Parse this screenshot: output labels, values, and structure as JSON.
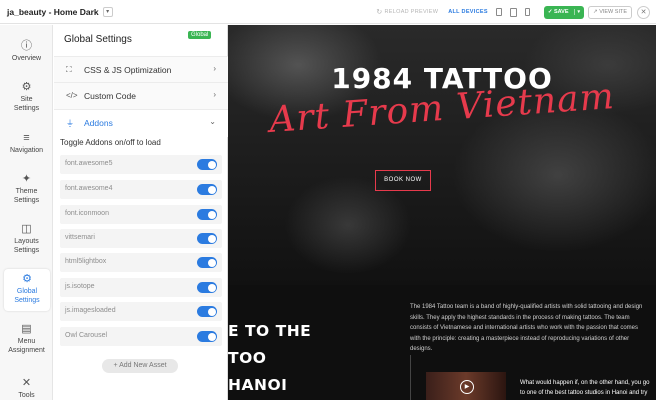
{
  "topbar": {
    "site_title": "ja_beauty - Home Dark",
    "reload_preview": "RELOAD PREVIEW",
    "all_devices": "ALL DEVICES",
    "save": "SAVE",
    "view_site": "VIEW SITE",
    "close": "✕"
  },
  "nav": {
    "items": [
      {
        "label": "Overview",
        "icon": "info-icon",
        "glyph": "ⓘ"
      },
      {
        "label": "Site Settings",
        "icon": "gears-icon",
        "glyph": "⚙"
      },
      {
        "label": "Navigation",
        "icon": "menu-icon",
        "glyph": "≡"
      },
      {
        "label": "Theme Settings",
        "icon": "magic-wand-icon",
        "glyph": "✦"
      },
      {
        "label": "Layouts Settings",
        "icon": "layout-icon",
        "glyph": "◫"
      },
      {
        "label": "Global Settings",
        "icon": "gears-icon",
        "glyph": "⚙"
      },
      {
        "label": "Menu Assignment",
        "icon": "list-icon",
        "glyph": "▤"
      },
      {
        "label": "Tools",
        "icon": "tools-icon",
        "glyph": "✕"
      }
    ]
  },
  "panel": {
    "title": "Global Settings",
    "badge": "Global",
    "sections": {
      "css_js": "CSS & JS Optimization",
      "custom_code": "Custom Code",
      "addons": "Addons"
    },
    "toggle_hint": "Toggle Addons on/off to load",
    "addons": [
      "font.awesome5",
      "font.awesome4",
      "font.iconmoon",
      "vittsemari",
      "html5lightbox",
      "js.isotope",
      "js.imagesloaded",
      "Owl Carousel"
    ],
    "add_asset": "+ Add New Asset"
  },
  "preview": {
    "hero_title": "1984 TATTOO",
    "hero_script": "Art From Vietnam",
    "book_now": "BOOK NOW",
    "welcome_lines": [
      "E TO THE",
      "TOO",
      "HANOI"
    ],
    "about_text": "The 1984 Tattoo team is a band of highly-qualified artists with solid tattooing and design skills. They apply the highest standards in the process of making tattoos. The team consists of Vietnamese and international artists who work with the passion that comes with the principle: creating a masterpiece instead of reproducing variations of other designs.",
    "quote_text": "What would happen if, on the other hand, you go to one of the best tattoo studios in Hanoi and try"
  }
}
